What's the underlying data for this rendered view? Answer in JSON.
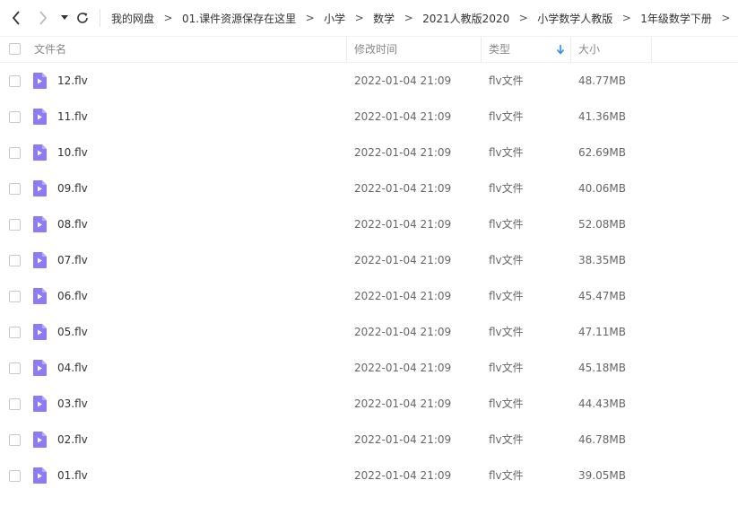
{
  "nav": {
    "back_icon": "chevron-left-icon",
    "forward_icon": "chevron-right-icon",
    "dropdown_icon": "caret-down-icon",
    "refresh_icon": "refresh-icon"
  },
  "breadcrumb": {
    "items": [
      "我的网盘",
      "01.课件资源保存在这里",
      "小学",
      "数学",
      "2021人教版2020",
      "小学数学人教版",
      "1年级数学下册"
    ],
    "separator": ">"
  },
  "table": {
    "columns": {
      "name": "文件名",
      "time": "修改时间",
      "type": "类型",
      "size": "大小"
    },
    "sort_icon": "sort-down-arrow-icon",
    "rows": [
      {
        "name": "12.flv",
        "time": "2022-01-04 21:09",
        "type": "flv文件",
        "size": "48.77MB"
      },
      {
        "name": "11.flv",
        "time": "2022-01-04 21:09",
        "type": "flv文件",
        "size": "41.36MB"
      },
      {
        "name": "10.flv",
        "time": "2022-01-04 21:09",
        "type": "flv文件",
        "size": "62.69MB"
      },
      {
        "name": "09.flv",
        "time": "2022-01-04 21:09",
        "type": "flv文件",
        "size": "40.06MB"
      },
      {
        "name": "08.flv",
        "time": "2022-01-04 21:09",
        "type": "flv文件",
        "size": "52.08MB"
      },
      {
        "name": "07.flv",
        "time": "2022-01-04 21:09",
        "type": "flv文件",
        "size": "38.35MB"
      },
      {
        "name": "06.flv",
        "time": "2022-01-04 21:09",
        "type": "flv文件",
        "size": "45.47MB"
      },
      {
        "name": "05.flv",
        "time": "2022-01-04 21:09",
        "type": "flv文件",
        "size": "47.11MB"
      },
      {
        "name": "04.flv",
        "time": "2022-01-04 21:09",
        "type": "flv文件",
        "size": "45.18MB"
      },
      {
        "name": "03.flv",
        "time": "2022-01-04 21:09",
        "type": "flv文件",
        "size": "44.43MB"
      },
      {
        "name": "02.flv",
        "time": "2022-01-04 21:09",
        "type": "flv文件",
        "size": "46.78MB"
      },
      {
        "name": "01.flv",
        "time": "2022-01-04 21:09",
        "type": "flv文件",
        "size": "39.05MB"
      }
    ]
  },
  "colors": {
    "video_icon": "#8b7cf6",
    "sort_arrow": "#2b8ef0",
    "text": "#333333",
    "muted": "#888888"
  }
}
